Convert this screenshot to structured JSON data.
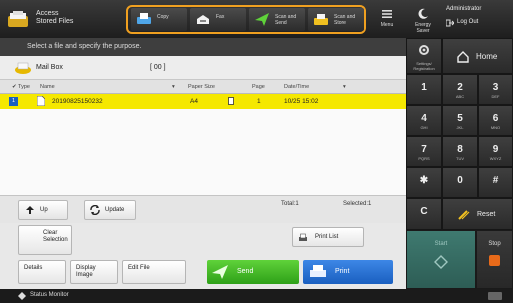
{
  "header": {
    "app_title_line1": "Access",
    "app_title_line2": "Stored Files",
    "functions": [
      {
        "label": "Copy",
        "icon": "copy-icon"
      },
      {
        "label": "Fax",
        "icon": "fax-icon"
      },
      {
        "label": "Scan and Send",
        "icon": "scan-send-icon"
      },
      {
        "label": "Scan and Store",
        "icon": "scan-store-icon"
      }
    ],
    "menu_label": "Menu",
    "energy_saver_label": "Energy Saver",
    "admin_label": "Administrator",
    "logout_label": "Log Out"
  },
  "instruction": "Select a file and specify the purpose.",
  "mailbox": {
    "name": "Mail Box",
    "number": "[ 00 ]"
  },
  "list": {
    "columns": [
      "Type",
      "Name",
      "Paper Size",
      "Page",
      "Date/Time"
    ],
    "rows": [
      {
        "index": "1",
        "name": "20190825150232",
        "paper": "A4",
        "pages": "1",
        "date": "10/25 15:02"
      }
    ]
  },
  "bottom": {
    "up_label": "Up",
    "update_label": "Update",
    "total": "Total:1",
    "selected": "Selected:1"
  },
  "actions": {
    "clear_selection": "Clear Selection",
    "print_list": "Print List",
    "details": "Details",
    "display_image": "Display Image",
    "edit_file": "Edit File",
    "send": "Send",
    "print": "Print"
  },
  "right": {
    "settings_label": "Settings/ Registration",
    "home_label": "Home",
    "keys": [
      {
        "d": "1",
        "s": ""
      },
      {
        "d": "2",
        "s": "ABC"
      },
      {
        "d": "3",
        "s": "DEF"
      },
      {
        "d": "4",
        "s": "GHI"
      },
      {
        "d": "5",
        "s": "JKL"
      },
      {
        "d": "6",
        "s": "MNO"
      },
      {
        "d": "7",
        "s": "PQRS"
      },
      {
        "d": "8",
        "s": "TUV"
      },
      {
        "d": "9",
        "s": "WXYZ"
      },
      {
        "d": "✱",
        "s": ""
      },
      {
        "d": "0",
        "s": ""
      },
      {
        "d": "#",
        "s": ""
      }
    ],
    "clear_label": "C",
    "reset_label": "Reset",
    "start_label": "Start",
    "stop_label": "Stop"
  },
  "status": {
    "label": "Status Monitor"
  },
  "colors": {
    "highlight": "#f5e800",
    "accent_orange": "#f0a020",
    "send_green": "#3cb820",
    "print_blue": "#2a70d4"
  }
}
